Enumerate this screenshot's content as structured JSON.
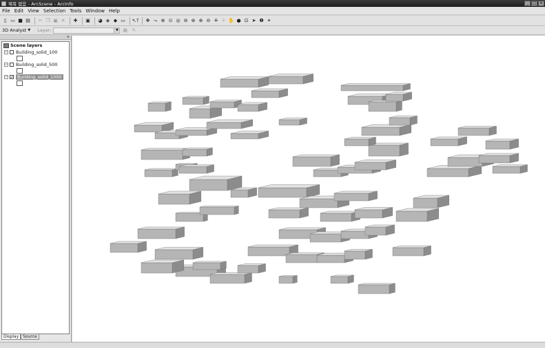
{
  "window": {
    "title": "제목 없음 - ArcScene - ArcInfo"
  },
  "menu": [
    "File",
    "Edit",
    "View",
    "Selection",
    "Tools",
    "Window",
    "Help"
  ],
  "toolbar2": {
    "analyst_label": "3D Analyst",
    "layer_label": "Layer:",
    "layer_value": ""
  },
  "toc": {
    "root_label": "Scene layers",
    "layers": [
      {
        "name": "Building_solid_100",
        "checked": false
      },
      {
        "name": "Building_solid_500",
        "checked": false
      },
      {
        "name": "Building_solid_1000",
        "checked": true
      }
    ],
    "tabs": [
      "Display",
      "Source"
    ]
  },
  "icons": {
    "standard": [
      "new-icon",
      "open-icon",
      "save-icon",
      "print-icon",
      "cut-icon",
      "copy-icon",
      "paste-icon",
      "delete-icon",
      "add-data-icon",
      "scene-properties-icon",
      "globe-icon",
      "layer-icon",
      "animation-icon",
      "zoom-window-icon",
      "full-screen-icon",
      "whats-this-icon"
    ],
    "tools": [
      "navigate-icon",
      "fly-icon",
      "target-center-icon",
      "zoom-target-icon",
      "set-observer-icon",
      "center-target-icon",
      "zoom-to-target-icon",
      "zoom-in-icon",
      "zoom-out-icon",
      "zoom-in-out-icon",
      "pan-icon",
      "full-extent-icon",
      "select-features-icon",
      "select-elements-icon",
      "identify-icon",
      "find-icon"
    ]
  }
}
